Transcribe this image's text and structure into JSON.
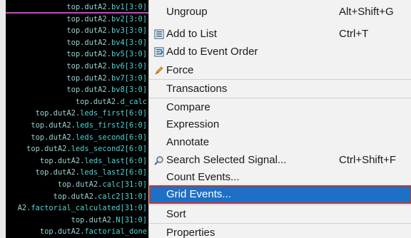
{
  "signals": [
    {
      "prefix": "top.dutA2.",
      "name": "bv1[3:0]",
      "selected": true
    },
    {
      "prefix": "top.dutA2.",
      "name": "bv2[3:0]"
    },
    {
      "prefix": "top.dutA2.",
      "name": "bv3[3:0]"
    },
    {
      "prefix": "top.dutA2.",
      "name": "bv4[3:0]"
    },
    {
      "prefix": "top.dutA2.",
      "name": "bv5[3:0]"
    },
    {
      "prefix": "top.dutA2.",
      "name": "bv6[3:0]"
    },
    {
      "prefix": "top.dutA2.",
      "name": "bv7[3:0]"
    },
    {
      "prefix": "top.dutA2.",
      "name": "bv8[3:0]"
    },
    {
      "prefix": "top.dutA2.",
      "name": "d_calc"
    },
    {
      "prefix": "top.dutA2.",
      "name": "leds_first[6:0]"
    },
    {
      "prefix": "top.dutA2.",
      "name": "leds_first2[6:0]"
    },
    {
      "prefix": "top.dutA2.",
      "name": "leds_second[6:0]"
    },
    {
      "prefix": "top.dutA2.",
      "name": "leds_second2[6:0]"
    },
    {
      "prefix": "top.dutA2.",
      "name": "leds_last[6:0]"
    },
    {
      "prefix": "top.dutA2.",
      "name": "leds_last2[6:0]"
    },
    {
      "prefix": "top.dutA2.",
      "name": "calc[31:0]"
    },
    {
      "prefix": "top.dutA2.",
      "name": "calc2[31:0]"
    },
    {
      "prefix": "A2.",
      "name": "factorial_calculated[31:0]"
    },
    {
      "prefix": "top.dutA2.",
      "name": "N[31:0]"
    },
    {
      "prefix": "top.dutA2.",
      "name": "factorial_done"
    }
  ],
  "menu": {
    "ungroup": {
      "label": "Ungroup",
      "shortcut": "Alt+Shift+G"
    },
    "add_to_list": {
      "label": "Add to List",
      "shortcut": "Ctrl+T",
      "icon": "list-add-icon"
    },
    "add_to_event_order": {
      "label": "Add to Event Order",
      "icon": "event-order-icon"
    },
    "force": {
      "label": "Force",
      "icon": "pencil-icon"
    },
    "transactions": {
      "label": "Transactions"
    },
    "compare": {
      "label": "Compare"
    },
    "expression": {
      "label": "Expression"
    },
    "annotate": {
      "label": "Annotate"
    },
    "search_selected_signal": {
      "label": "Search Selected Signal...",
      "shortcut": "Ctrl+Shift+F",
      "icon": "search-signal-icon"
    },
    "count_events": {
      "label": "Count Events..."
    },
    "grid_events": {
      "label": "Grid Events...",
      "highlighted": true
    },
    "sort": {
      "label": "Sort"
    },
    "properties": {
      "label": "Properties"
    }
  },
  "colors": {
    "signal_bg": "#000000",
    "signal_text": "#4fd4d4",
    "selected_underline": "#cc44cc",
    "menu_bg": "#f2f2f2",
    "menu_highlight": "#1e6fc6",
    "highlight_outline": "#c0392b"
  }
}
